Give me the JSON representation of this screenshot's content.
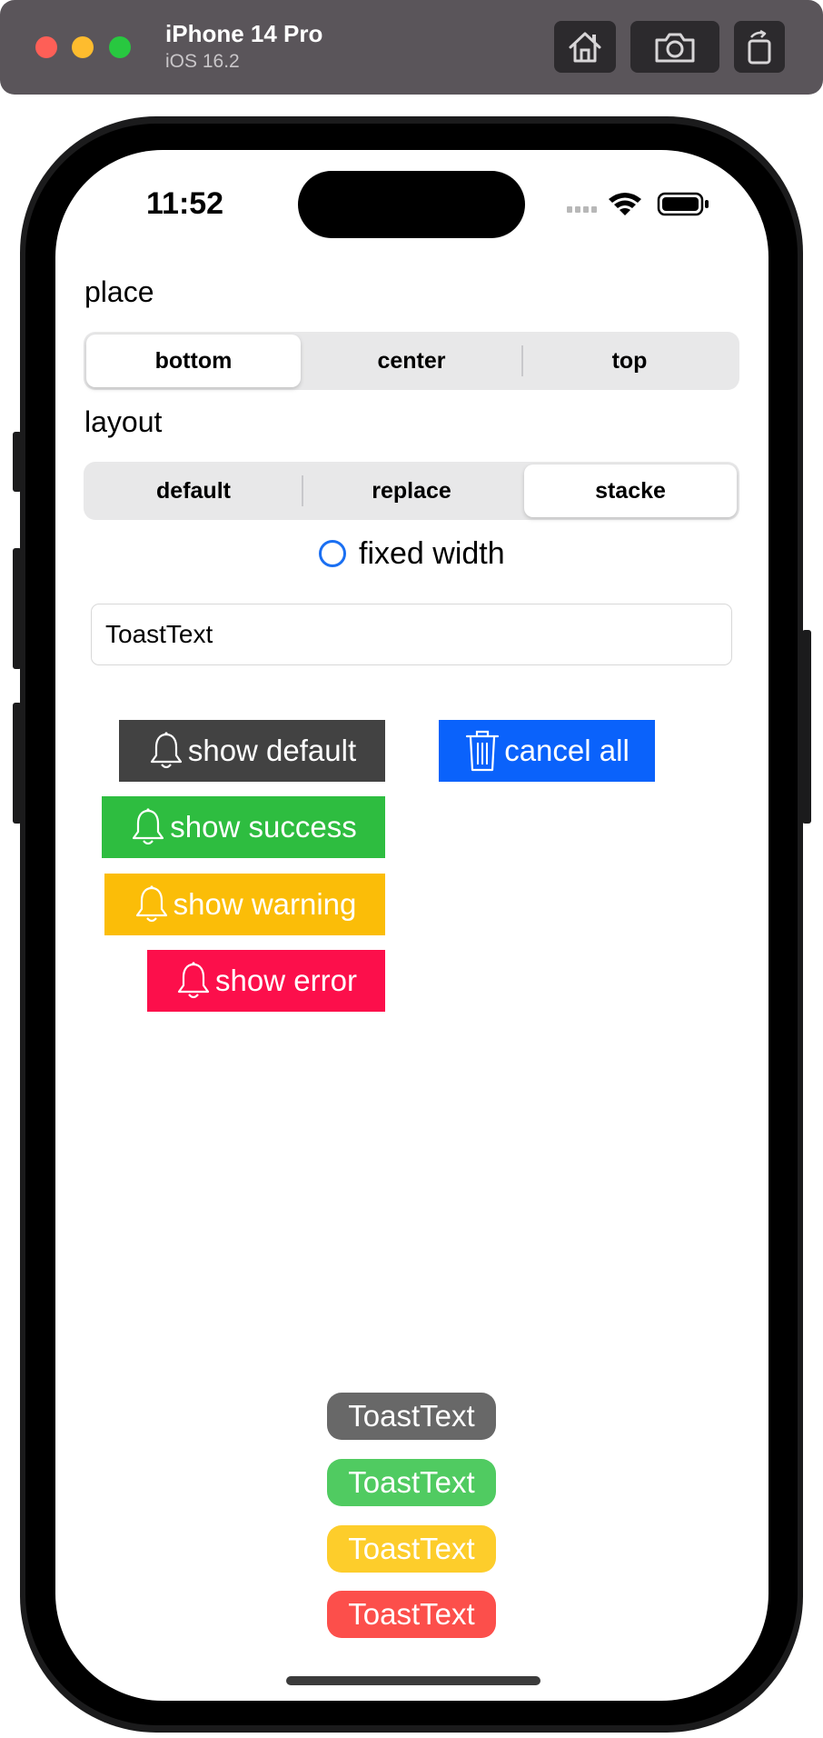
{
  "simulator": {
    "device_name": "iPhone 14 Pro",
    "os_version": "iOS 16.2",
    "toolbar_icons": [
      "home-icon",
      "screenshot-icon",
      "rotate-icon"
    ]
  },
  "status_bar": {
    "time": "11:52",
    "icons": [
      "cellular-icon",
      "wifi-icon",
      "battery-icon"
    ]
  },
  "place": {
    "label": "place",
    "options": [
      "bottom",
      "center",
      "top"
    ],
    "selected": "bottom"
  },
  "layout": {
    "label": "layout",
    "options": [
      "default",
      "replace",
      "stacke"
    ],
    "selected": "stacke"
  },
  "fixed_width": {
    "label": "fixed width",
    "checked": false
  },
  "toast_input": {
    "value": "ToastText"
  },
  "buttons": {
    "show_default": {
      "label": "show default",
      "icon": "bell-icon",
      "color": "#424242"
    },
    "show_success": {
      "label": "show success",
      "icon": "bell-icon",
      "color": "#2ebd40"
    },
    "show_warning": {
      "label": "show warning",
      "icon": "bell-icon",
      "color": "#fbbd08"
    },
    "show_error": {
      "label": "show error",
      "icon": "bell-icon",
      "color": "#fc0f4b"
    },
    "cancel_all": {
      "label": "cancel all",
      "icon": "trash-icon",
      "color": "#0a62fb"
    }
  },
  "toasts": [
    {
      "text": "ToastText",
      "color": "#686868"
    },
    {
      "text": "ToastText",
      "color": "#50cb61"
    },
    {
      "text": "ToastText",
      "color": "#fdcd2b"
    },
    {
      "text": "ToastText",
      "color": "#fc4f4b"
    }
  ]
}
